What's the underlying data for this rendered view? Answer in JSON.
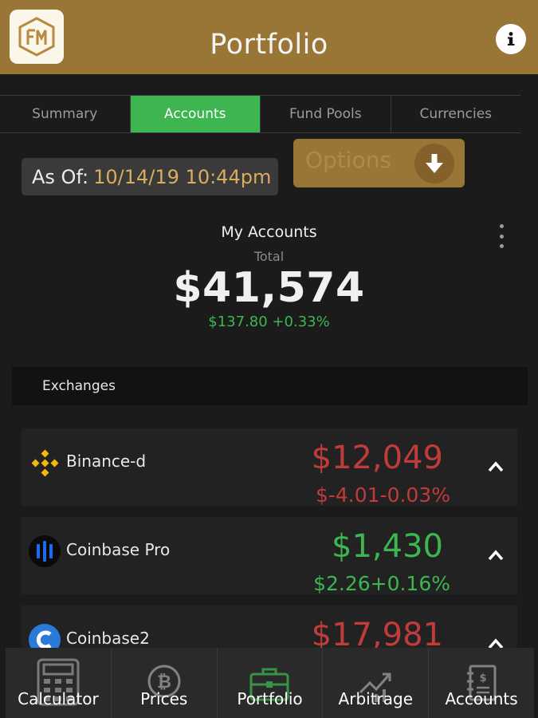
{
  "header": {
    "title": "Portfolio",
    "logo_icon": "fm-logo-icon",
    "info_icon": "info-icon"
  },
  "tabs": [
    {
      "label": "Summary",
      "active": false
    },
    {
      "label": "Accounts",
      "active": true
    },
    {
      "label": "Fund Pools",
      "active": false
    },
    {
      "label": "Currencies",
      "active": false
    }
  ],
  "as_of": {
    "label": "As Of:",
    "value": "10/14/19 10:44pm"
  },
  "options": {
    "label": "Options",
    "icon": "arrow-down-icon"
  },
  "summary": {
    "title": "My Accounts",
    "total_label": "Total",
    "total_value": "$41,574",
    "total_change": "$137.80 +0.33%"
  },
  "section": {
    "label": "Exchanges"
  },
  "exchanges": [
    {
      "name": "Binance-d",
      "value": "$12,049",
      "change": "$-4.01-0.03%",
      "status": "negative",
      "icon": "binance-icon"
    },
    {
      "name": "Coinbase Pro",
      "value": "$1,430",
      "change": "$2.26+0.16%",
      "status": "positive",
      "icon": "coinbase-pro-icon"
    },
    {
      "name": "Coinbase2",
      "value": "$17,981",
      "change": "",
      "status": "negative",
      "icon": "coinbase-icon"
    }
  ],
  "bottom_nav": [
    {
      "label": "Calculator",
      "icon": "calculator-icon"
    },
    {
      "label": "Prices",
      "icon": "bitcoin-icon"
    },
    {
      "label": "Portfolio",
      "icon": "briefcase-icon"
    },
    {
      "label": "Arbitrage",
      "icon": "chart-icon"
    },
    {
      "label": "Accounts",
      "icon": "ledger-icon"
    }
  ],
  "colors": {
    "gold": "#9a7636",
    "green": "#3db651",
    "red": "#c23b3b",
    "background": "#1b1b1b"
  }
}
